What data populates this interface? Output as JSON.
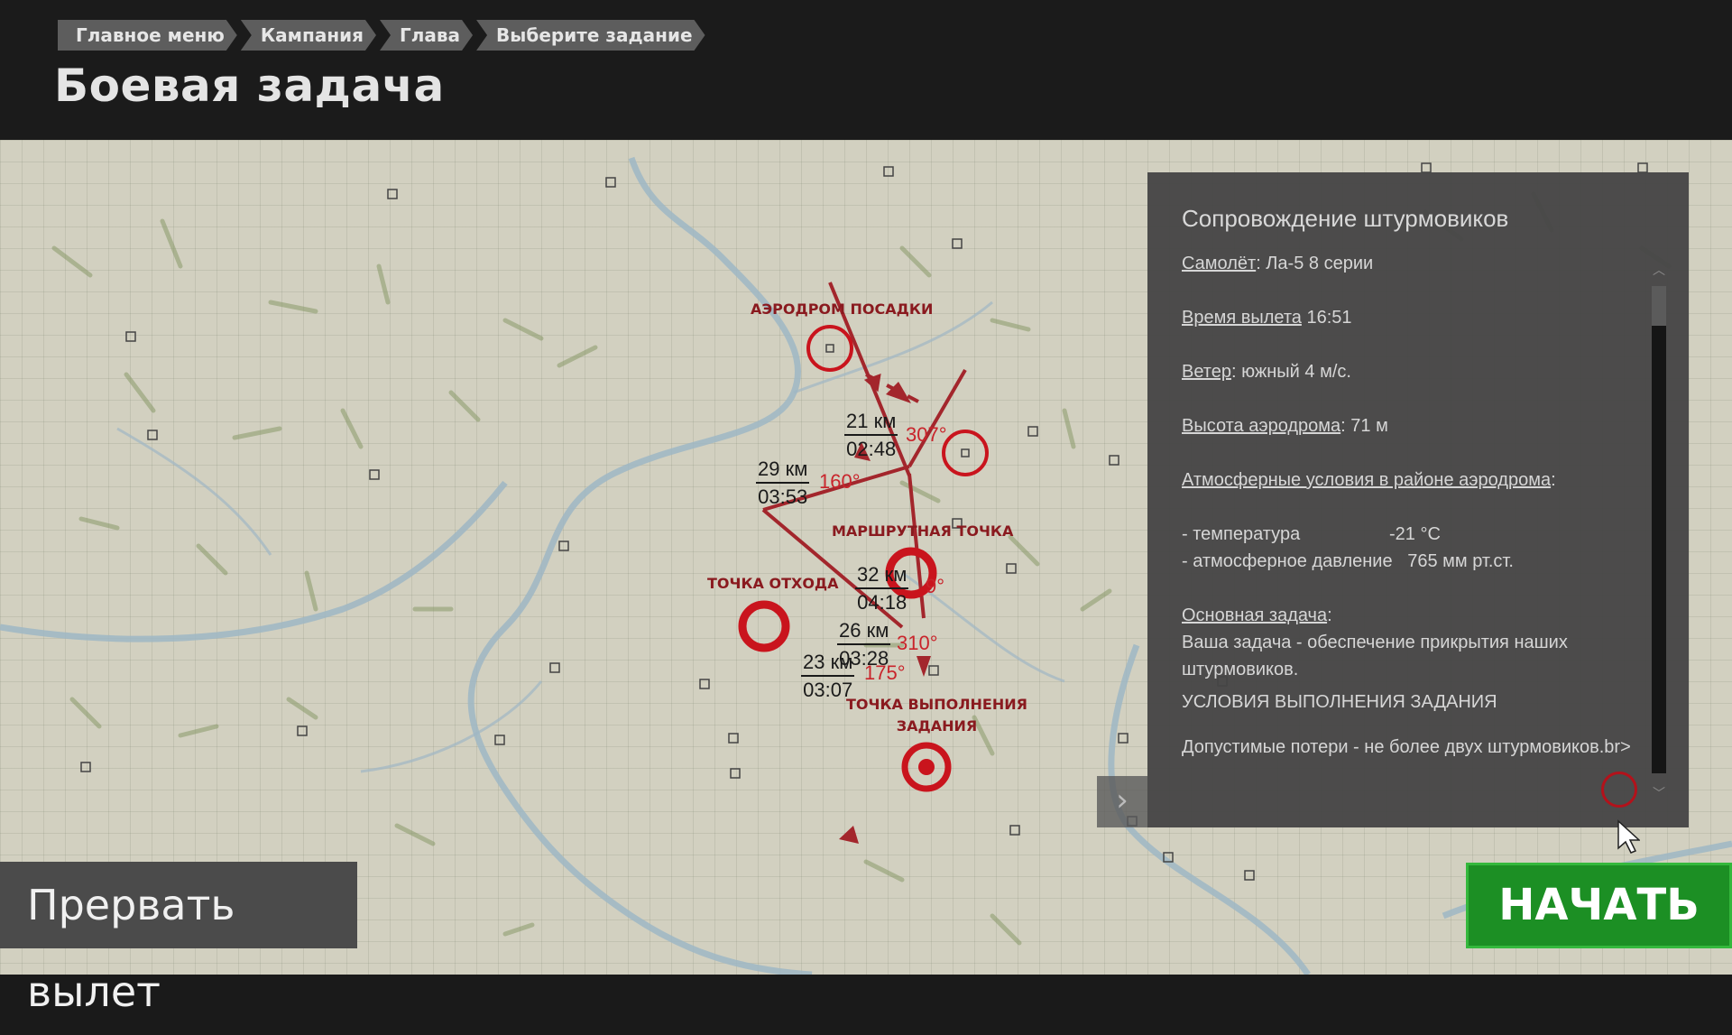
{
  "breadcrumb": [
    "Главное меню",
    "Кампания",
    "Глава",
    "Выберите задание"
  ],
  "page_title": "Боевая задача",
  "map": {
    "labels": {
      "landing_airfield": "АЭРОДРОМ ПОСАДКИ",
      "waypoint": "МАРШРУТНАЯ ТОЧКА",
      "egress_point": "ТОЧКА ОТХОДА",
      "objective_point_line1": "ТОЧКА ВЫПОЛНЕНИЯ",
      "objective_point_line2": "ЗАДАНИЯ"
    },
    "legs": [
      {
        "distance": "21 км",
        "time": "02:48",
        "heading": "307°"
      },
      {
        "distance": "29 км",
        "time": "03:53",
        "heading": "160°"
      },
      {
        "distance": "32 км",
        "time": "04:18",
        "heading": "9°"
      },
      {
        "distance": "26 км",
        "time": "03:28",
        "heading": "310°"
      },
      {
        "distance": "23 км",
        "time": "03:07",
        "heading": "175°"
      }
    ]
  },
  "briefing": {
    "title": "Сопровождение штурмовиков",
    "aircraft_label": "Самолёт",
    "aircraft_value": ": Ла-5 8 серии",
    "departure_label": "Время вылета",
    "departure_value": " 16:51",
    "wind_label": "Ветер",
    "wind_value": ": южный 4 м/с.",
    "elevation_label": "Высота аэродрома",
    "elevation_value": ": 71 м",
    "weather_label": "Атмосферные условия в районе аэродрома",
    "weather_colon": ":",
    "temp_label": " - температура",
    "temp_value": "-21 °C",
    "pressure_label": " - атмосферное давление",
    "pressure_value": "765 мм рт.ст.",
    "main_task_label": "Основная задача",
    "main_task_colon": ":",
    "main_task_text": "Ваша задача - обеспечение прикрытия наших штурмовиков.",
    "conditions_header": "УСЛОВИЯ ВЫПОЛНЕНИЯ ЗАДАНИЯ",
    "conditions_text": "Допустимые потери - не более двух штурмовиков.br>"
  },
  "buttons": {
    "abort": "Прервать вылет",
    "start": "НАЧАТЬ"
  },
  "colors": {
    "route": "#a3262c",
    "marker": "#c9141d",
    "start_button": "#1c8f24",
    "panel": "#464646"
  }
}
